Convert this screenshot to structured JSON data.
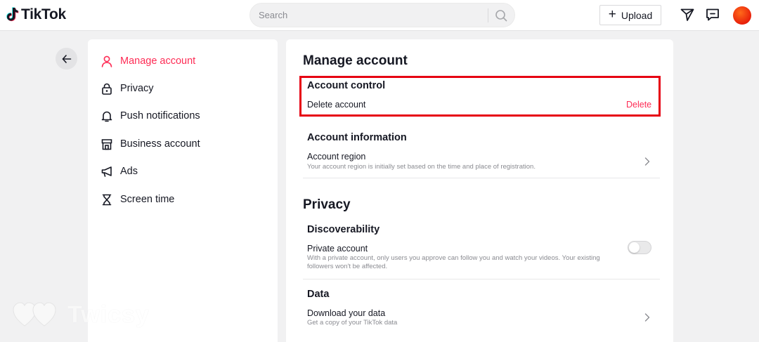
{
  "header": {
    "brand": "TikTok",
    "search_placeholder": "Search",
    "upload_label": "Upload",
    "colors": {
      "accent": "#fe2c55",
      "avatar": "#ee2a0a"
    }
  },
  "sidebar": {
    "items": [
      {
        "label": "Manage account",
        "icon": "person-icon",
        "active": true
      },
      {
        "label": "Privacy",
        "icon": "lock-icon"
      },
      {
        "label": "Push notifications",
        "icon": "bell-icon"
      },
      {
        "label": "Business account",
        "icon": "store-icon"
      },
      {
        "label": "Ads",
        "icon": "megaphone-icon"
      },
      {
        "label": "Screen time",
        "icon": "hourglass-icon"
      }
    ]
  },
  "main": {
    "manage_title": "Manage account",
    "account_control": {
      "title": "Account control",
      "delete_label": "Delete account",
      "delete_action": "Delete"
    },
    "account_information": {
      "title": "Account information",
      "region_label": "Account region",
      "region_desc": "Your account region is initially set based on the time and place of registration."
    },
    "privacy_title": "Privacy",
    "discoverability": {
      "title": "Discoverability",
      "private_label": "Private account",
      "private_desc": "With a private account, only users you approve can follow you and watch your videos. Your existing followers won't be affected.",
      "private_enabled": false
    },
    "data": {
      "title": "Data",
      "download_label": "Download your data",
      "download_desc": "Get a copy of your TikTok data"
    }
  },
  "watermark": {
    "text": "Twicsy"
  }
}
